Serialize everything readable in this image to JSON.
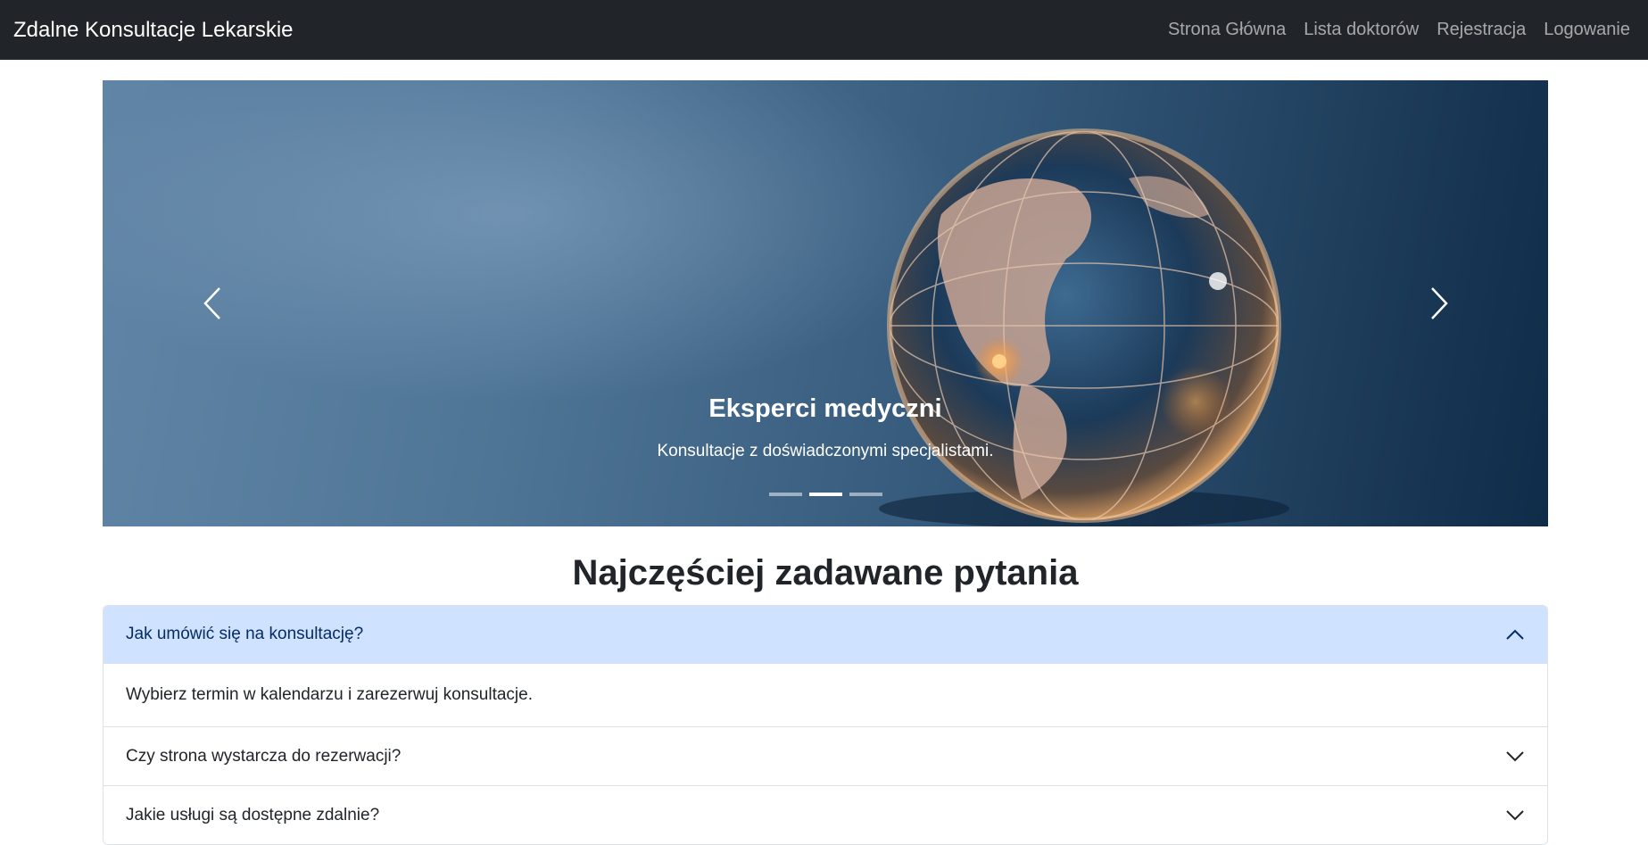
{
  "navbar": {
    "brand": "Zdalne Konsultacje Lekarskie",
    "links": [
      "Strona Główna",
      "Lista doktorów",
      "Rejestracja",
      "Logowanie"
    ]
  },
  "carousel": {
    "caption_title": "Eksperci medyczni",
    "caption_text": "Konsultacje z doświadczonymi specjalistami.",
    "slide_count": 3,
    "active_slide": 2,
    "prev_icon": "chevron-left-icon",
    "next_icon": "chevron-right-icon"
  },
  "faq": {
    "title": "Najczęściej zadawane pytania",
    "items": [
      {
        "question": "Jak umówić się na konsultację?",
        "answer": "Wybierz termin w kalendarzu i zarezerwuj konsultacje.",
        "expanded": true
      },
      {
        "question": "Czy strona wystarcza do rezerwacji?",
        "expanded": false
      },
      {
        "question": "Jakie usługi są dostępne zdalnie?",
        "expanded": false
      }
    ]
  },
  "colors": {
    "navbar_bg": "#212529",
    "accordion_open_bg": "#cfe2ff",
    "accordion_open_text": "#052c65"
  }
}
